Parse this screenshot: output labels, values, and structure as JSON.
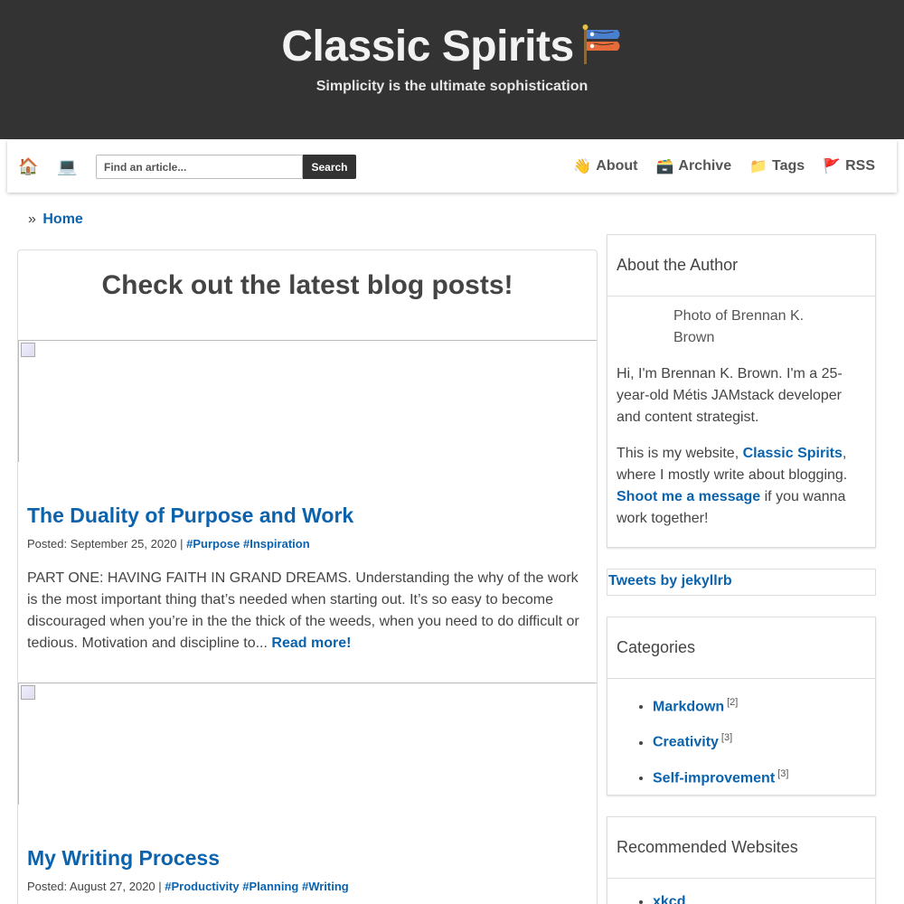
{
  "header": {
    "title": "Classic Spirits",
    "tagline": "Simplicity is the ultimate sophistication"
  },
  "nav": {
    "home_icon": "house-icon",
    "laptop_icon": "laptop-icon",
    "search_placeholder": "Find an article...",
    "search_button": "Search",
    "links": [
      {
        "emoji": "👋",
        "label": "About"
      },
      {
        "emoji": "🗃️",
        "label": "Archive"
      },
      {
        "emoji": "📁",
        "label": "Tags"
      },
      {
        "emoji": "🚩",
        "label": "RSS"
      }
    ]
  },
  "breadcrumb": {
    "separator": "»",
    "home": "Home"
  },
  "main": {
    "heading": "Check out the latest blog posts!",
    "posts": [
      {
        "title": "The Duality of Purpose and Work",
        "posted": "Posted: September 25, 2020 |",
        "tags": "#Purpose #Inspiration",
        "excerpt": "PART ONE: HAVING FAITH IN GRAND DREAMS. Understanding the why of the work is the most important thing that’s needed when starting out. It’s so easy to become discouraged when you’re in the the thick of the weeds, when you need to do difficult or tedious. Motivation and discipline to...",
        "read_more": "Read more!"
      },
      {
        "title": "My Writing Process",
        "posted": "Posted: August 27, 2020 |",
        "tags": "#Productivity #Planning #Writing"
      }
    ]
  },
  "sidebar": {
    "about": {
      "heading": "About the Author",
      "photo_alt": "Photo of Brennan K. Brown",
      "bio": "Hi, I'm Brennan K. Brown. I'm a 25-year-old Métis JAMstack developer and content strategist.",
      "site_prefix": "This is my website, ",
      "site_link": "Classic Spirits",
      "site_suffix": ", where I mostly write about blogging. ",
      "contact_link": "Shoot me a message",
      "contact_suffix": " if you wanna work together!"
    },
    "tweets": "Tweets by jekyllrb",
    "categories": {
      "heading": "Categories",
      "items": [
        {
          "name": "Markdown",
          "count": "[2]"
        },
        {
          "name": "Creativity",
          "count": "[3]"
        },
        {
          "name": "Self-improvement",
          "count": "[3]"
        }
      ]
    },
    "recommended": {
      "heading": "Recommended Websites",
      "items": [
        "xkcd"
      ]
    }
  }
}
